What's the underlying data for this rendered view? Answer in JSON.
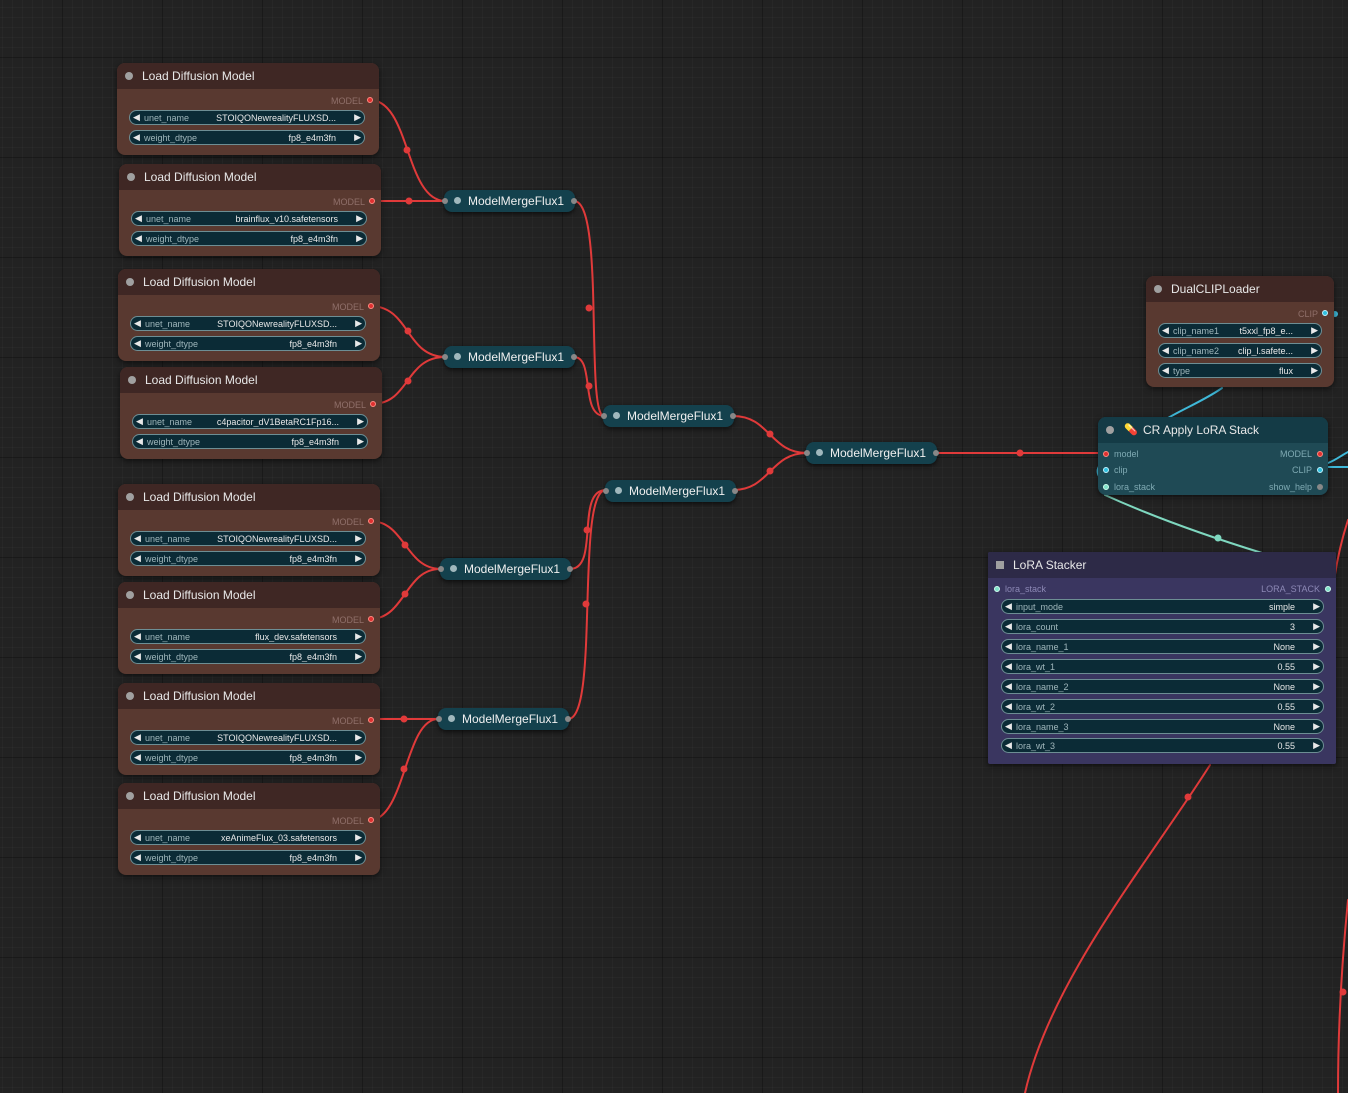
{
  "load_nodes": [
    {
      "title": "Load Diffusion Model",
      "output": "MODEL",
      "unet_label": "unet_name",
      "unet_value": "STOIQONewrealityFLUXSD...",
      "dtype_label": "weight_dtype",
      "dtype_value": "fp8_e4m3fn"
    },
    {
      "title": "Load Diffusion Model",
      "output": "MODEL",
      "unet_label": "unet_name",
      "unet_value": "brainflux_v10.safetensors",
      "dtype_label": "weight_dtype",
      "dtype_value": "fp8_e4m3fn"
    },
    {
      "title": "Load Diffusion Model",
      "output": "MODEL",
      "unet_label": "unet_name",
      "unet_value": "STOIQONewrealityFLUXSD...",
      "dtype_label": "weight_dtype",
      "dtype_value": "fp8_e4m3fn"
    },
    {
      "title": "Load Diffusion Model",
      "output": "MODEL",
      "unet_label": "unet_name",
      "unet_value": "c4pacitor_dV1BetaRC1Fp16...",
      "dtype_label": "weight_dtype",
      "dtype_value": "fp8_e4m3fn"
    },
    {
      "title": "Load Diffusion Model",
      "output": "MODEL",
      "unet_label": "unet_name",
      "unet_value": "STOIQONewrealityFLUXSD...",
      "dtype_label": "weight_dtype",
      "dtype_value": "fp8_e4m3fn"
    },
    {
      "title": "Load Diffusion Model",
      "output": "MODEL",
      "unet_label": "unet_name",
      "unet_value": "flux_dev.safetensors",
      "dtype_label": "weight_dtype",
      "dtype_value": "fp8_e4m3fn"
    },
    {
      "title": "Load Diffusion Model",
      "output": "MODEL",
      "unet_label": "unet_name",
      "unet_value": "STOIQONewrealityFLUXSD...",
      "dtype_label": "weight_dtype",
      "dtype_value": "fp8_e4m3fn"
    },
    {
      "title": "Load Diffusion Model",
      "output": "MODEL",
      "unet_label": "unet_name",
      "unet_value": "xeAnimeFlux_03.safetensors",
      "dtype_label": "weight_dtype",
      "dtype_value": "fp8_e4m3fn"
    }
  ],
  "merge_label": "ModelMergeFlux1",
  "dual_clip": {
    "title": "DualCLIPLoader",
    "output": "CLIP",
    "widgets": [
      {
        "label": "clip_name1",
        "value": "t5xxl_fp8_e..."
      },
      {
        "label": "clip_name2",
        "value": "clip_l.safete..."
      },
      {
        "label": "type",
        "value": "flux"
      }
    ]
  },
  "cr_apply": {
    "title": "CR Apply LoRA Stack",
    "inputs": [
      "model",
      "clip",
      "lora_stack"
    ],
    "outputs": [
      "MODEL",
      "CLIP",
      "show_help"
    ]
  },
  "lora_stacker": {
    "title": "LoRA Stacker",
    "input": "lora_stack",
    "output": "LORA_STACK",
    "widgets": [
      {
        "label": "input_mode",
        "value": "simple"
      },
      {
        "label": "lora_count",
        "value": "3"
      },
      {
        "label": "lora_name_1",
        "value": "None"
      },
      {
        "label": "lora_wt_1",
        "value": "0.55"
      },
      {
        "label": "lora_name_2",
        "value": "None"
      },
      {
        "label": "lora_wt_2",
        "value": "0.55"
      },
      {
        "label": "lora_name_3",
        "value": "None"
      },
      {
        "label": "lora_wt_3",
        "value": "0.55"
      }
    ]
  },
  "colors": {
    "model_wire": "#e03a3a",
    "clip_wire": "#3fb8d8",
    "stack_wire": "#7fd8c0"
  }
}
